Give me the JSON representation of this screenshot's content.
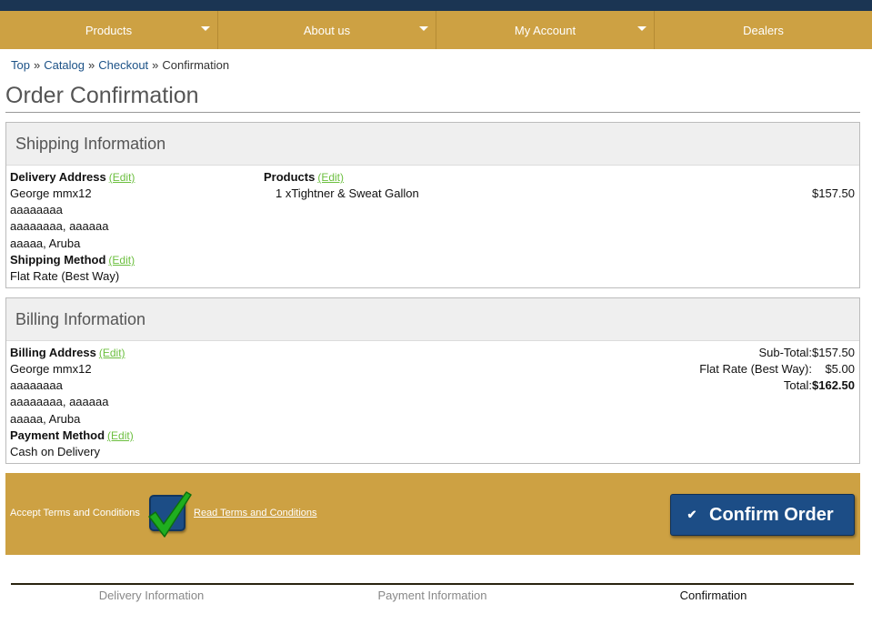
{
  "nav": {
    "items": [
      {
        "label": "Products",
        "has_menu": true
      },
      {
        "label": "About us",
        "has_menu": true
      },
      {
        "label": "My Account",
        "has_menu": true
      },
      {
        "label": "Dealers",
        "has_menu": false
      }
    ]
  },
  "breadcrumb": {
    "items": [
      "Top",
      "Catalog",
      "Checkout"
    ],
    "current": "Confirmation",
    "separator": "»"
  },
  "page": {
    "title": "Order Confirmation"
  },
  "shipping": {
    "heading": "Shipping Information",
    "delivery_label": "Delivery Address",
    "edit_label": "(Edit)",
    "address": [
      "George mmx12",
      "aaaaaaaa",
      "aaaaaaaa, aaaaaa",
      "aaaaa, Aruba"
    ],
    "method_label": "Shipping Method",
    "method": "Flat Rate (Best Way)",
    "products_label": "Products",
    "product_line": "1 xTightner & Sweat Gallon",
    "product_price": "$157.50"
  },
  "billing": {
    "heading": "Billing Information",
    "address_label": "Billing Address",
    "edit_label": "(Edit)",
    "address": [
      "George mmx12",
      "aaaaaaaa",
      "aaaaaaaa, aaaaaa",
      "aaaaa, Aruba"
    ],
    "payment_label": "Payment Method",
    "payment": "Cash on Delivery",
    "subtotal_label": "Sub-Total:",
    "subtotal": "$157.50",
    "shipping_label": "Flat Rate (Best Way):",
    "shipping_cost": "$5.00",
    "total_label": "Total:",
    "total": "$162.50"
  },
  "terms": {
    "label": "Accept Terms and Conditions",
    "checked": true,
    "link": "Read Terms and Conditions"
  },
  "confirm": {
    "tick": "✔",
    "label": "Confirm Order"
  },
  "steps": {
    "items": [
      "Delivery Information",
      "Payment Information",
      "Confirmation"
    ],
    "active": "Confirmation"
  },
  "colors": {
    "topbar": "#1b3553",
    "accent_gold": "#cda143",
    "link_blue": "#1c5287",
    "edit_green": "#6cbf3f",
    "button_blue": "#1c4d86",
    "check_green": "#1fae1f"
  }
}
